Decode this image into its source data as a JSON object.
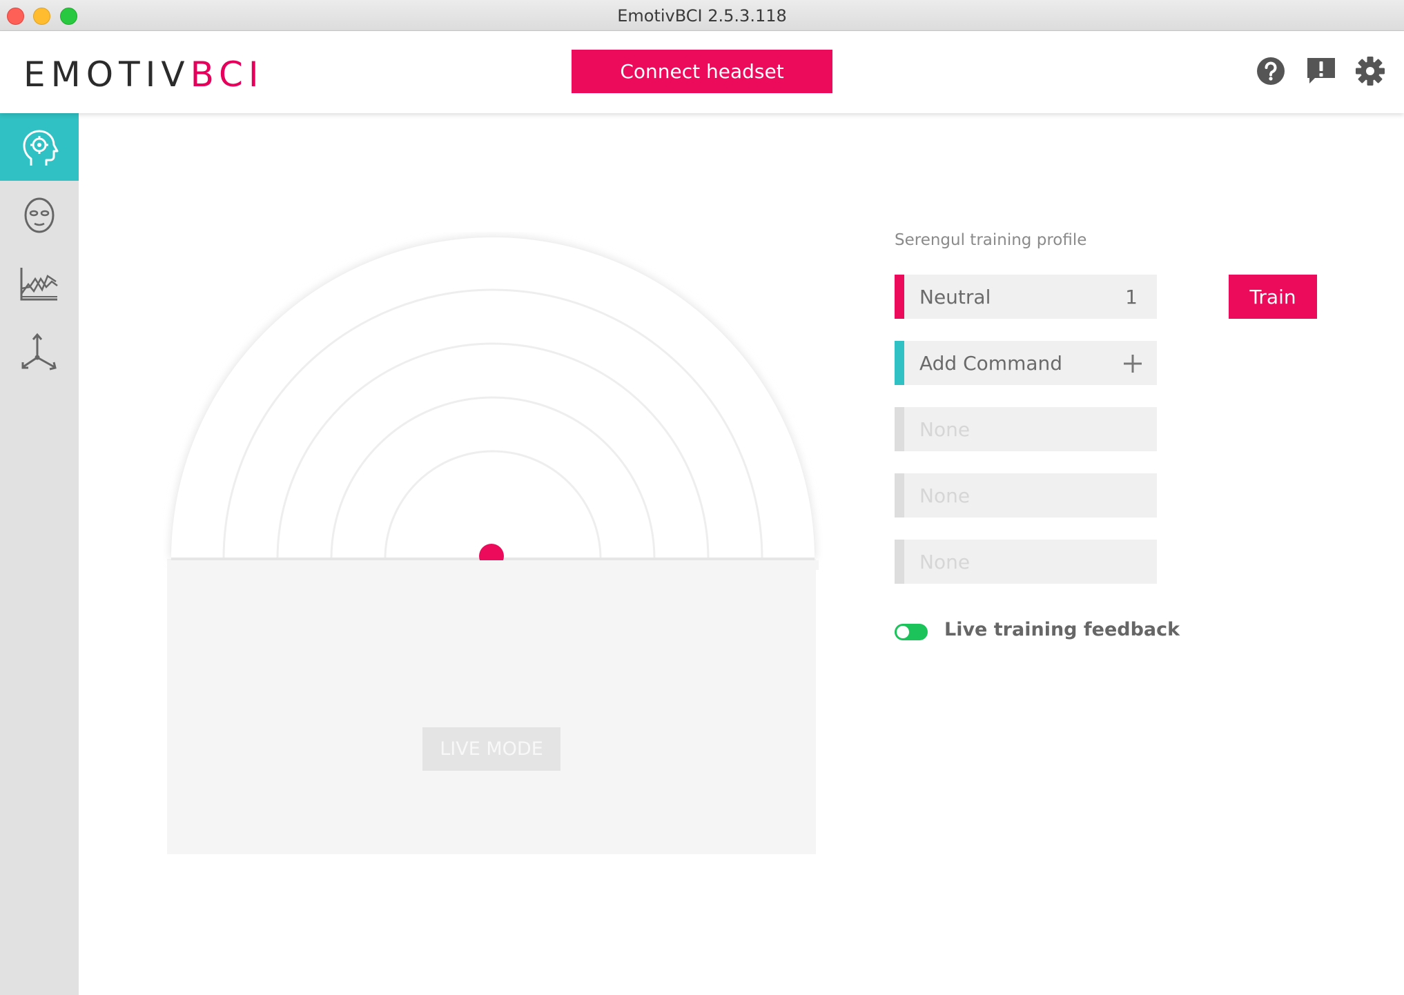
{
  "window": {
    "title": "EmotivBCI 2.5.3.118"
  },
  "header": {
    "logo_part1": "EMOTIV",
    "logo_part2": "BCI",
    "connect_label": "Connect headset",
    "icons": [
      "help-icon",
      "feedback-icon",
      "settings-icon"
    ]
  },
  "sidebar": {
    "items": [
      {
        "name": "mental-commands",
        "icon": "brain-head-icon",
        "active": true
      },
      {
        "name": "facial-expressions",
        "icon": "face-icon",
        "active": false
      },
      {
        "name": "performance-metrics",
        "icon": "chart-icon",
        "active": false
      },
      {
        "name": "motion",
        "icon": "axes-icon",
        "active": false
      }
    ]
  },
  "main": {
    "live_mode_label": "LIVE MODE",
    "indicator_color": "#ec0b5b"
  },
  "training": {
    "profile_label": "Serengul training profile",
    "commands": [
      {
        "label": "Neutral",
        "count": "1",
        "bar_color": "#ec0b5b",
        "enabled": true
      },
      {
        "label": "Add Command",
        "bar_color": "#2fc1c3",
        "enabled": true,
        "action": "plus-icon"
      },
      {
        "label": "None",
        "bar_color": "#dddddd",
        "enabled": false
      },
      {
        "label": "None",
        "bar_color": "#dddddd",
        "enabled": false
      },
      {
        "label": "None",
        "bar_color": "#dddddd",
        "enabled": false
      }
    ],
    "train_label": "Train",
    "live_feedback_label": "Live training feedback",
    "live_feedback_on": true
  },
  "colors": {
    "accent": "#ec0b5b",
    "teal": "#2fc1c3",
    "toggle_on": "#1cc35a"
  }
}
